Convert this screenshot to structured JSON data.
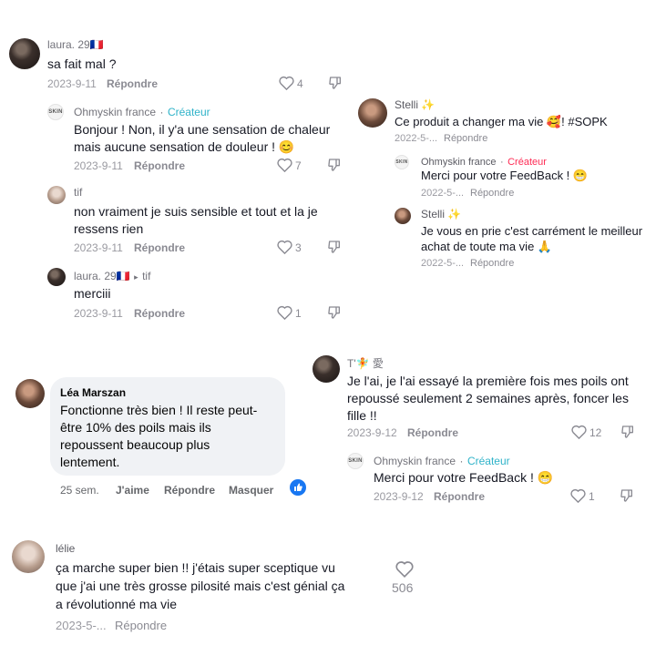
{
  "panel_tl": {
    "c1": {
      "user": "laura. 29🇫🇷",
      "text": "sa fait mal ?",
      "date": "2023-9-11",
      "reply": "Répondre",
      "likes": "4"
    },
    "c2": {
      "user": "Ohmyskin france",
      "sep": "·",
      "role": "Créateur",
      "text1": "Bonjour ! Non, il y'a une sensation de chaleur",
      "text2": "mais aucune sensation de douleur ! 😊",
      "date": "2023-9-11",
      "reply": "Répondre",
      "likes": "7"
    },
    "c3": {
      "user": "tif",
      "text1": "non vraiment je suis sensible et tout et la je",
      "text2": "ressens rien",
      "date": "2023-9-11",
      "reply": "Répondre",
      "likes": "3"
    },
    "c4": {
      "user": "laura. 29🇫🇷",
      "arrow": "▸",
      "to": "tif",
      "text": "merciii",
      "date": "2023-9-11",
      "reply": "Répondre",
      "likes": "1"
    }
  },
  "panel_tr": {
    "c1": {
      "user": "Stelli ✨",
      "text": "Ce produit a changer ma vie 🥰! #SOPK",
      "date": "2022-5-...",
      "reply": "Répondre"
    },
    "c2": {
      "user": "Ohmyskin france",
      "sep": "·",
      "role": "Créateur",
      "text": "Merci pour votre FeedBack ! 😁",
      "date": "2022-5-...",
      "reply": "Répondre"
    },
    "c3": {
      "user": "Stelli ✨",
      "text1": "Je vous en prie c'est carrément le meilleur",
      "text2": "achat de toute ma vie 🙏",
      "date": "2022-5-...",
      "reply": "Répondre"
    }
  },
  "panel_ml": {
    "name": "Léa Marszan",
    "lines": [
      "Fonctionne très bien ! Il reste peut-",
      "être 10% des poils mais ils",
      "repoussent beaucoup plus",
      "lentement."
    ],
    "time": "25 sem.",
    "like": "J'aime",
    "reply": "Répondre",
    "hide": "Masquer"
  },
  "panel_mr": {
    "c1": {
      "user": "T'🧚 愛",
      "text1": "Je l'ai, je l'ai essayé la première fois mes poils ont",
      "text2": "repoussé seulement 2 semaines après, foncer les",
      "text3": "fille !!",
      "date": "2023-9-12",
      "reply": "Répondre",
      "likes": "12"
    },
    "c2": {
      "user": "Ohmyskin france",
      "sep": "·",
      "role": "Créateur",
      "text": "Merci pour votre FeedBack ! 😁",
      "date": "2023-9-12",
      "reply": "Répondre",
      "likes": "1"
    }
  },
  "panel_bl": {
    "user": "lélie",
    "text1": "ça marche super bien !! j'étais super sceptique vu",
    "text2": "que j'ai une très grosse pilosité mais c'est génial ça",
    "text3": "a révolutionné ma vie",
    "date": "2023-5-...",
    "reply": "Répondre",
    "likes": "506"
  },
  "brand_logo": "SKIN",
  "colors": {
    "creator_blue": "#2fb3c9",
    "creator_pink": "#fe2c55",
    "fb_blue": "#1877f2",
    "bubble": "#f0f2f5"
  }
}
